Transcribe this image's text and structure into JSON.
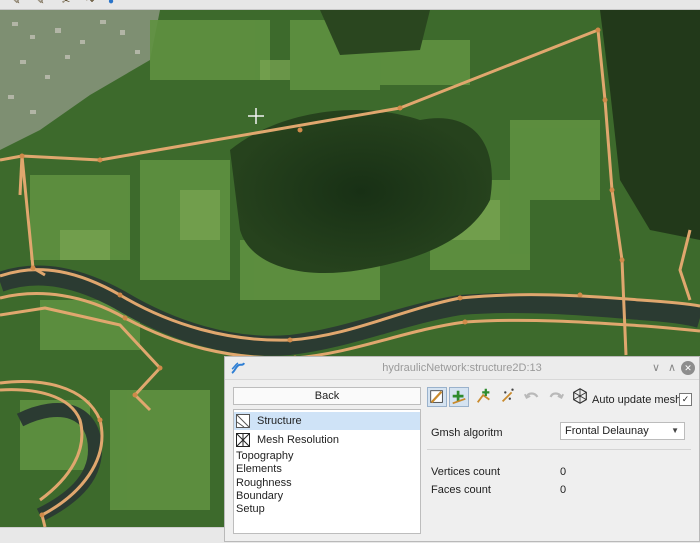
{
  "window": {
    "title": "hydraulicNetwork:structure2D:13",
    "minimize_glyph": "∨",
    "maximize_glyph": "∧",
    "close_glyph": "✕"
  },
  "nav": {
    "back_label": "Back",
    "items": [
      {
        "label": "Structure",
        "icon": "structure-icon",
        "selected": true
      },
      {
        "label": "Mesh Resolution",
        "icon": "mesh-resolution-icon",
        "selected": false
      },
      {
        "label": "Topography"
      },
      {
        "label": "Elements"
      },
      {
        "label": "Roughness"
      },
      {
        "label": "Boundary"
      },
      {
        "label": "Setup"
      }
    ]
  },
  "toolbar": {
    "tools": [
      "edit-structure-icon",
      "add-point-icon",
      "add-polyline-icon",
      "magic-points-icon",
      "undo-icon",
      "redo-icon",
      "mesh-icon"
    ],
    "auto_update_label": "Auto update mesh",
    "auto_update_checked": true,
    "check_glyph": "✓"
  },
  "gmsh": {
    "label": "Gmsh algoritm",
    "value": "Frontal Delaunay"
  },
  "counts": {
    "vertices_label": "Vertices count",
    "vertices_value": "0",
    "faces_label": "Faces count",
    "faces_value": "0"
  },
  "colors": {
    "polyline": "#e0a76e",
    "river": "#2b3b32",
    "selection": "#cfe3f7"
  }
}
